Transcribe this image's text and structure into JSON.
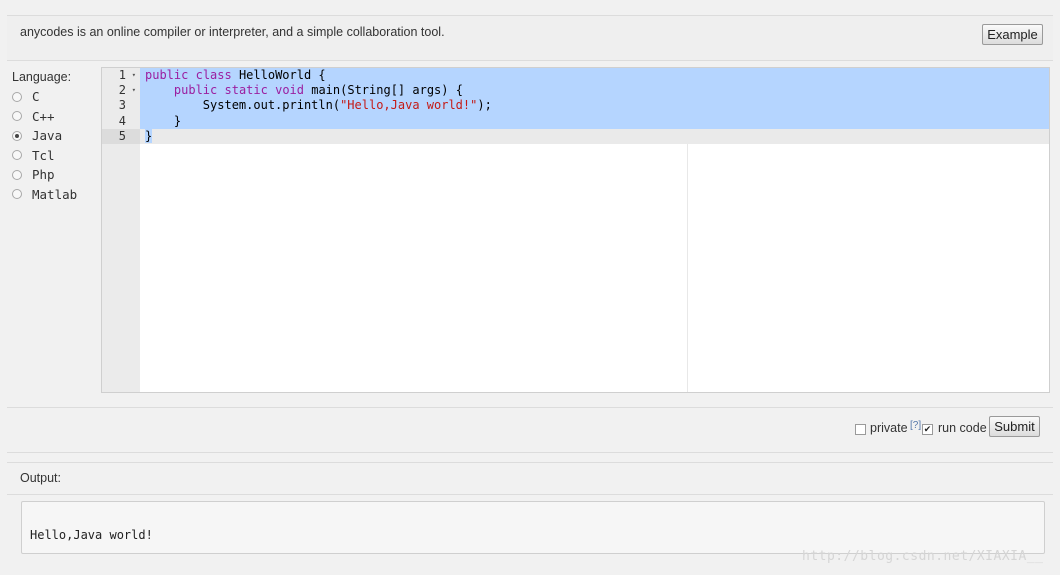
{
  "header": {
    "description": "anycodes is an online compiler or interpreter, and a simple collaboration tool.",
    "example_label": "Example"
  },
  "language": {
    "title": "Language:",
    "options": [
      "C",
      "C++",
      "Java",
      "Tcl",
      "Php",
      "Matlab"
    ],
    "selected": "Java"
  },
  "editor": {
    "line_numbers": [
      "1",
      "2",
      "3",
      "4",
      "5"
    ],
    "lines": [
      {
        "indent": "",
        "tokens": [
          [
            "kw",
            "public"
          ],
          [
            "t",
            " "
          ],
          [
            "kw",
            "class"
          ],
          [
            "t",
            " HelloWorld {"
          ]
        ]
      },
      {
        "indent": "    ",
        "tokens": [
          [
            "kw",
            "public"
          ],
          [
            "t",
            " "
          ],
          [
            "kw",
            "static"
          ],
          [
            "t",
            " "
          ],
          [
            "kw",
            "void"
          ],
          [
            "t",
            " main(String[] args) {"
          ]
        ]
      },
      {
        "indent": "        ",
        "tokens": [
          [
            "t",
            "System.out.println("
          ],
          [
            "str",
            "\"Hello,Java world!\""
          ],
          [
            "t",
            ");"
          ]
        ]
      },
      {
        "indent": "    ",
        "tokens": [
          [
            "t",
            "}"
          ]
        ]
      },
      {
        "indent": "",
        "tokens": [
          [
            "t",
            "}"
          ]
        ]
      }
    ]
  },
  "controls": {
    "private_label": "private",
    "help_label": "[?]",
    "run_code_label": "run code",
    "private_checked": false,
    "run_code_checked": true,
    "submit_label": "Submit"
  },
  "output": {
    "title": "Output:",
    "text": "Hello,Java world!"
  },
  "watermark": "http://blog.csdn.net/XIAXIA__",
  "colors": {
    "selection": "#b5d5ff",
    "keyword": "#9b1fa0",
    "string": "#c41a16"
  }
}
